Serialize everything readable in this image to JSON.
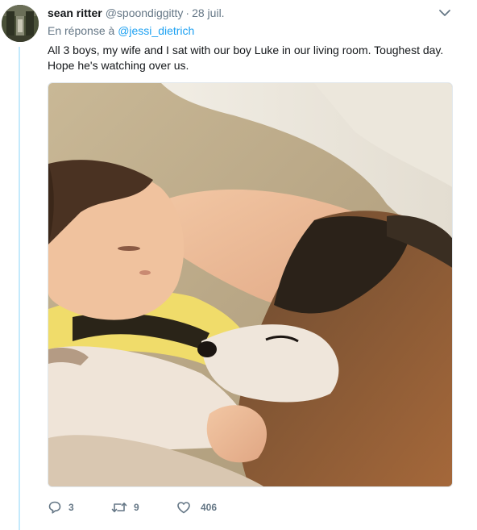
{
  "tweet": {
    "fullname": "sean ritter",
    "username": "@spoondiggitty",
    "separator": "·",
    "timestamp": "28 juil.",
    "reply_prefix": "En réponse à",
    "reply_mention": "@jessi_dietrich",
    "text": "All 3 boys, my wife and I sat with our boy Luke in our living room. Toughest day. Hope he's watching over us.",
    "actions": {
      "reply_count": "3",
      "retweet_count": "9",
      "like_count": "406"
    },
    "icons": {
      "more": "chevron-down-icon",
      "reply": "reply-icon",
      "retweet": "retweet-icon",
      "like": "heart-icon"
    },
    "colors": {
      "link": "#1da1f2",
      "secondary_text": "#657786",
      "thread_line": "#c4eafc"
    }
  }
}
